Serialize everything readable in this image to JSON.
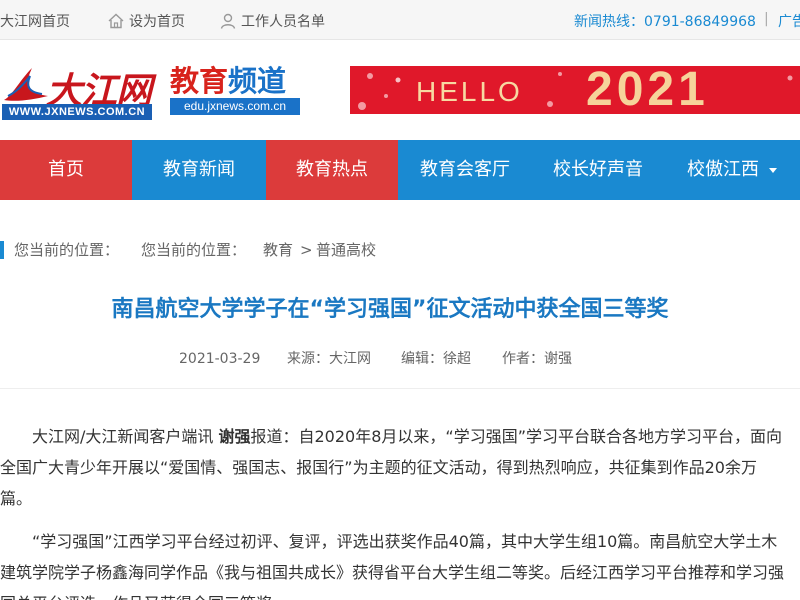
{
  "topbar": {
    "home": "大江网首页",
    "set_home": "设为首页",
    "staff_list": "工作人员名单",
    "hotline": "新闻热线：0791-86849968",
    "separator": "|",
    "ad": "广告"
  },
  "header": {
    "dajiang_logo_text": "大江网",
    "dajiang_logo_url": "WWW.JXNEWS.COM.CN",
    "edu_title_a": "教育",
    "edu_title_b": "频道",
    "edu_url": "edu.jxnews.com.cn",
    "banner_hello": "HELLO",
    "banner_year": "2021"
  },
  "nav": {
    "items": [
      {
        "label": "首页"
      },
      {
        "label": "教育新闻"
      },
      {
        "label": "教育热点"
      },
      {
        "label": "教育会客厅"
      },
      {
        "label": "校长好声音"
      },
      {
        "label": "校傲江西"
      }
    ]
  },
  "breadcrumb": {
    "prefix_1": "您当前的位置：",
    "prefix_2": "您当前的位置：",
    "level_1": "教育",
    "arrow": ">",
    "level_2": "普通高校"
  },
  "article": {
    "title": "南昌航空大学学子在“学习强国”征文活动中获全国三等奖",
    "date": "2021-03-29",
    "source": "来源：大江网",
    "editor": "编辑：徐超",
    "author": "作者：谢强",
    "p1_a": "大江网/大江新闻客户端讯 ",
    "p1_bold": "谢强",
    "p1_b": "报道：自2020年8月以来，“学习强国”学习平台联合各地方学习平台，面向全国广大青少年开展以“爱国情、强国志、报国行”为主题的征文活动，得到热烈响应，共征集到作品20余万篇。",
    "p2": "“学习强国”江西学习平台经过初评、复评，评选出获奖作品40篇，其中大学生组10篇。南昌航空大学土木建筑学院学子杨鑫海同学作品《我与祖国共成长》获得省平台大学生组二等奖。后经江西学习平台推荐和学习强国总平台评选，作品又获得全国三等奖。"
  },
  "colors": {
    "accent_blue": "#1a8ad2",
    "nav_active_red": "#dc3b3b",
    "title_blue": "#1a78c2",
    "banner_red": "#e0182a"
  },
  "icons": {
    "set_home": "home-icon",
    "staff": "person-icon",
    "dropdown": "caret-down-icon"
  }
}
